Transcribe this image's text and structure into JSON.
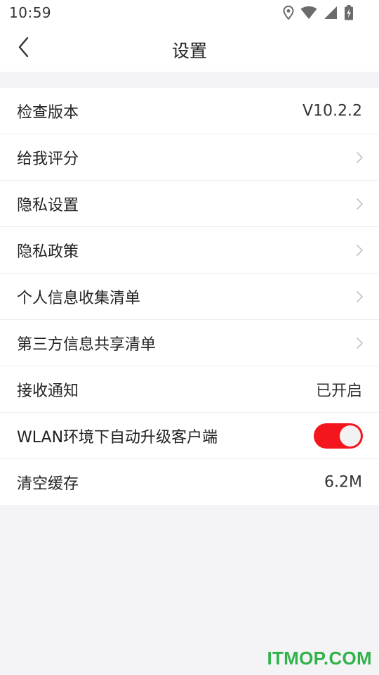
{
  "status_bar": {
    "time": "10:59",
    "icons": [
      "location-icon",
      "wifi-icon",
      "signal-icon",
      "battery-charging-icon"
    ]
  },
  "nav": {
    "title": "设置",
    "back_icon": "chevron-left-icon"
  },
  "settings": {
    "items": [
      {
        "label": "检查版本",
        "value": "V10.2.2"
      },
      {
        "label": "给我评分"
      },
      {
        "label": "隐私设置"
      },
      {
        "label": "隐私政策"
      },
      {
        "label": "个人信息收集清单"
      },
      {
        "label": "第三方信息共享清单"
      },
      {
        "label": "接收通知",
        "value": "已开启"
      },
      {
        "label": "WLAN环境下自动升级客户端",
        "toggle_on": true
      },
      {
        "label": "清空缓存",
        "value": "6.2M"
      }
    ]
  },
  "watermark": {
    "text": "ITMOP.COM"
  },
  "colors": {
    "toggle_on": "#f3161d",
    "watermark": "#32b24a",
    "page_bg": "#f4f4f6",
    "chevron": "#c2c2c2"
  }
}
